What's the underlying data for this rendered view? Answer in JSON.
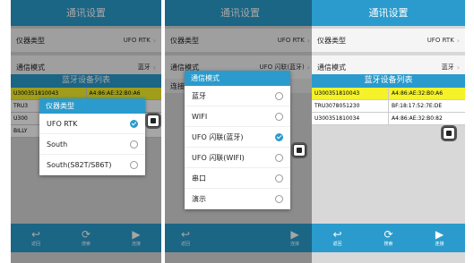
{
  "panel1": {
    "title": "通讯设置",
    "instrument_type": {
      "label": "仪器类型",
      "value": "UFO RTK"
    },
    "comm_mode": {
      "label": "通信模式",
      "value": "蓝牙"
    },
    "list_header": "蓝牙设备列表",
    "devices": [
      {
        "name": "U300351810043",
        "mac": "A4:86:AE:32:B0:A6"
      },
      {
        "name": "TRU3",
        "mac": "DE"
      },
      {
        "name": "U300",
        "mac": "82"
      },
      {
        "name": "BILLY",
        "mac": "78"
      }
    ],
    "dialog": {
      "title": "仪器类型",
      "options": [
        {
          "label": "UFO RTK",
          "selected": true
        },
        {
          "label": "South",
          "selected": false
        },
        {
          "label": "South(S82T/S86T)",
          "selected": false
        }
      ]
    },
    "toolbar": {
      "back": "返回",
      "search": "搜索",
      "connect": "连接"
    }
  },
  "panel2": {
    "title": "通讯设置",
    "instrument_type": {
      "label": "仪器类型",
      "value": "UFO RTK"
    },
    "comm_mode": {
      "label": "通信模式",
      "value": "UFO 闪联(蓝牙)"
    },
    "hidden_label": "连接",
    "dialog": {
      "title": "通信模式",
      "options": [
        {
          "label": "蓝牙",
          "selected": false
        },
        {
          "label": "WIFI",
          "selected": false
        },
        {
          "label": "UFO 闪联(蓝牙)",
          "selected": true
        },
        {
          "label": "UFO 闪联(WIFI)",
          "selected": false
        },
        {
          "label": "串口",
          "selected": false
        },
        {
          "label": "演示",
          "selected": false
        }
      ]
    },
    "toolbar": {
      "back": "返回",
      "connect": "连接"
    }
  },
  "panel3": {
    "title": "通讯设置",
    "instrument_type": {
      "label": "仪器类型",
      "value": "UFO RTK"
    },
    "comm_mode": {
      "label": "通信模式",
      "value": "蓝牙"
    },
    "list_header": "蓝牙设备列表",
    "devices": [
      {
        "name": "U300351810043",
        "mac": "A4:86:AE:32:B0:A6"
      },
      {
        "name": "TRU3078051230",
        "mac": "BF:18:17:52:7E:DE"
      },
      {
        "name": "U300351810034",
        "mac": "A4:86:AE:32:B0:82"
      }
    ],
    "toolbar": {
      "back": "返回",
      "search": "搜索",
      "connect": "连接"
    }
  },
  "colors": {
    "accent": "#2a9bcc",
    "selected_row": "#f5f22a"
  }
}
